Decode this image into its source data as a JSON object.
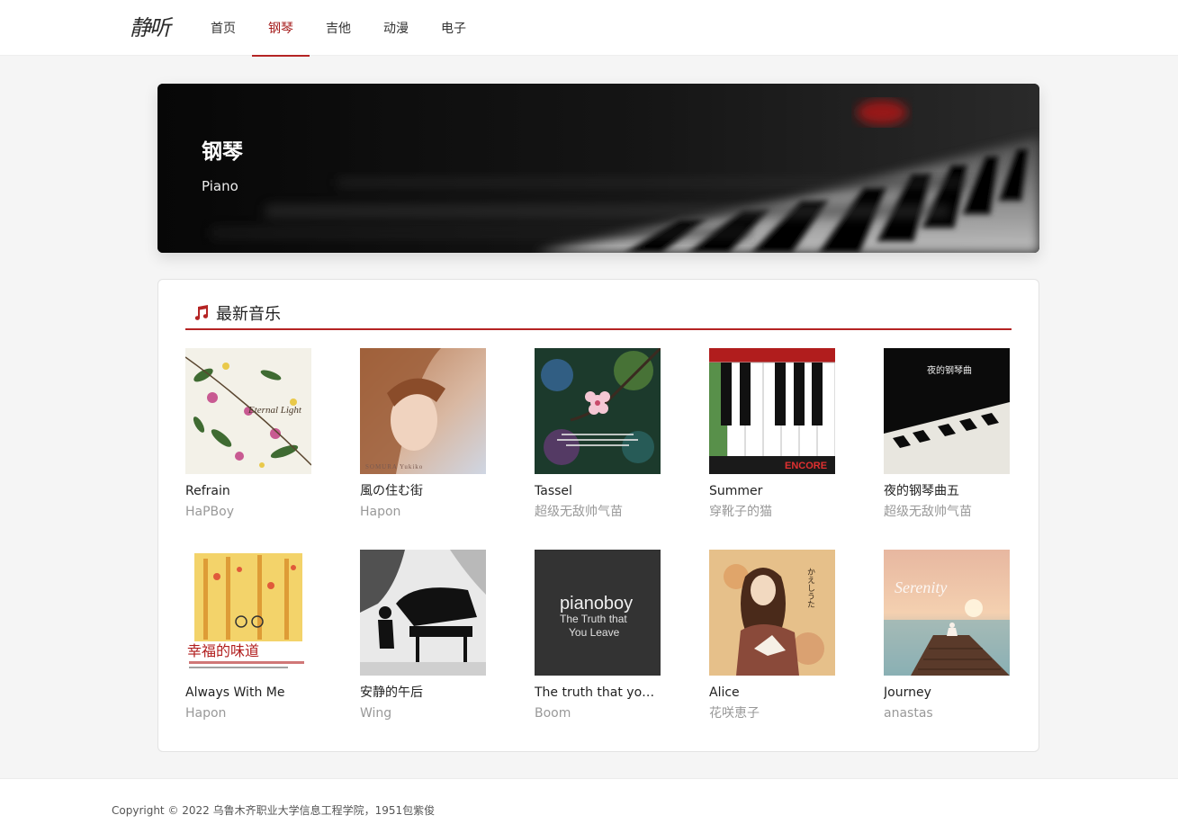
{
  "header": {
    "logo": "静听",
    "nav": [
      "首页",
      "钢琴",
      "吉他",
      "动漫",
      "电子"
    ],
    "active_nav": "钢琴",
    "accent": "#b52424"
  },
  "banner": {
    "title": "钢琴",
    "subtitle": "Piano"
  },
  "section": {
    "icon": "music-note-icon",
    "title": "最新音乐"
  },
  "songs": [
    {
      "title": "Refrain",
      "artist": "HaPBoy",
      "cover_text": "Eternal Light"
    },
    {
      "title": "風の住む街",
      "artist": "Hapon",
      "cover_text": "SOMURA Yukiko"
    },
    {
      "title": "Tassel",
      "artist": "超级无敌帅气苗",
      "cover_text": ""
    },
    {
      "title": "Summer",
      "artist": "穿靴子的猫",
      "cover_text": "ENCORE"
    },
    {
      "title": "夜的钢琴曲五",
      "artist": "超级无敌帅气苗",
      "cover_text": "夜的钢琴曲"
    },
    {
      "title": "Always With Me",
      "artist": "Hapon",
      "cover_text": "幸福的味道"
    },
    {
      "title": "安静的午后",
      "artist": "Wing",
      "cover_text": ""
    },
    {
      "title": "The truth that you ...",
      "artist": "Boom",
      "cover_text": "pianoboy"
    },
    {
      "title": "Alice",
      "artist": "花咲恵子",
      "cover_text": "かえしうた"
    },
    {
      "title": "Journey",
      "artist": "anastas",
      "cover_text": "Serenity"
    }
  ],
  "footer": {
    "copyright": "Copyright © 2022 乌鲁木齐职业大学信息工程学院，1951包紫俊"
  }
}
